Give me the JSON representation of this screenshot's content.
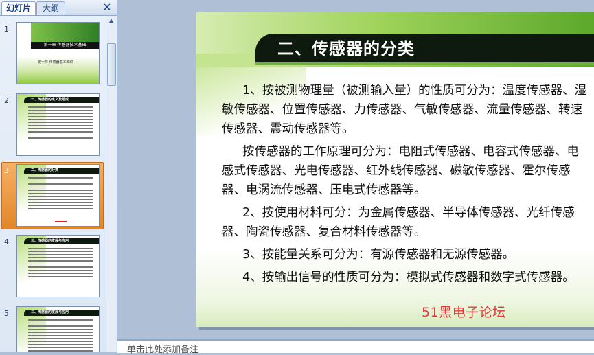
{
  "tabs": {
    "slides_label": "幻灯片",
    "outline_label": "大纲",
    "close_icon": "close-icon"
  },
  "thumbnails": [
    {
      "number": "1",
      "title": "第一章 传感器技术基础",
      "subtitle": "第一节 传感器基本知识"
    },
    {
      "number": "2",
      "title": "一、传感器的定义及组成"
    },
    {
      "number": "3",
      "title": "二、传感器的分类",
      "selected": true
    },
    {
      "number": "4",
      "title": "三、传感器的发展与应用"
    },
    {
      "number": "5",
      "title": "三、传感器的发展与应用"
    }
  ],
  "slide": {
    "title": "二、传感器的分类",
    "paragraphs": [
      "1、按被测物理量（被测输入量）的性质可分为：温度传感器、湿敏传感器、位置传感器、力传感器、气敏传感器、流量传感器、转速传感器、震动传感器等。",
      "按传感器的工作原理可分为：电阻式传感器、电容式传感器、电感式传感器、光电传感器、红外线传感器、磁敏传感器、霍尔传感器、电涡流传感器、压电式传感器等。",
      "2、按使用材料可分：为金属传感器、半导体传感器、光纤传感器、陶瓷传感器、复合材料传感器等。",
      "3、按能量关系可分为：有源传感器和无源传感器。",
      "4、按输出信号的性质可分为：模拟式传感器和数字式传感器。"
    ],
    "watermark": "51黑电子论坛"
  },
  "notes": {
    "placeholder": "单击此处添加备注"
  },
  "colors": {
    "title_bar": "#0e1a0e",
    "accent_green": "#59a72a",
    "selection": "#e2862a",
    "watermark": "#e23a3a"
  }
}
